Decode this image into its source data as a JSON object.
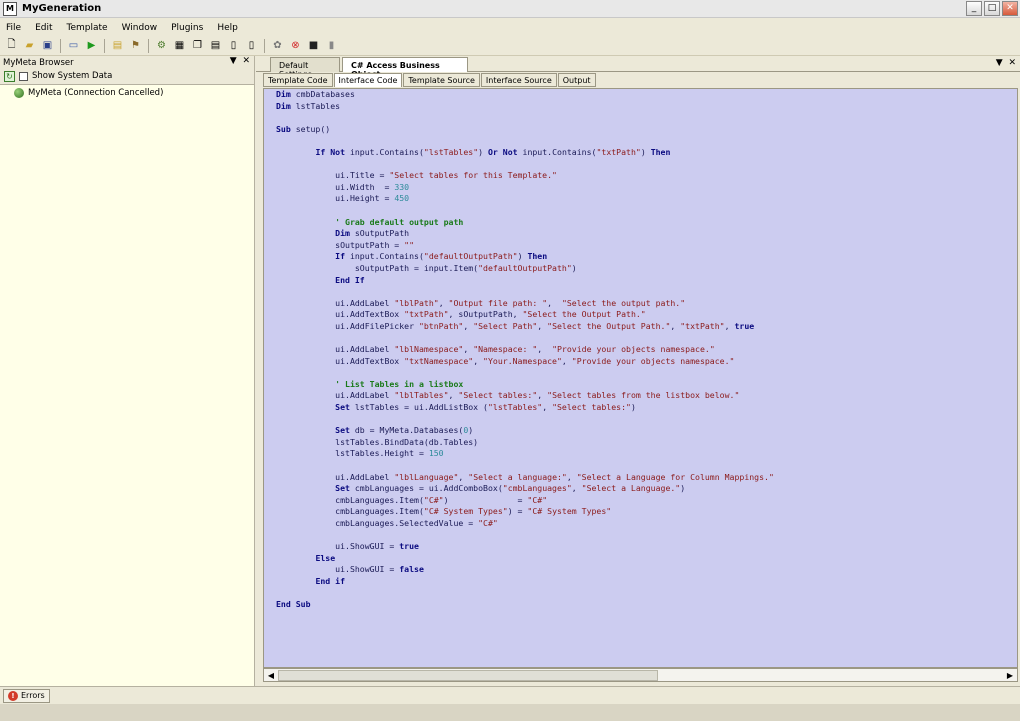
{
  "window": {
    "title": "MyGeneration"
  },
  "menu": [
    "File",
    "Edit",
    "Template",
    "Window",
    "Plugins",
    "Help"
  ],
  "toolbar_icons": [
    "new-icon",
    "open-icon",
    "save-icon",
    "properties-icon",
    "run-icon",
    "folder-icon",
    "wand-icon",
    "build-icon",
    "grid-icon",
    "copy-icon",
    "paste-icon",
    "page-icon",
    "page2-icon",
    "tools-icon",
    "stop-icon",
    "monitor-icon",
    "plugin-icon"
  ],
  "left_panel": {
    "title": "MyMeta Browser",
    "show_system_data": "Show System Data",
    "tree_root": "MyMeta (Connection Cancelled)"
  },
  "doc_tabs": [
    "Default Settings",
    "C# Access Business Object"
  ],
  "sub_tabs": [
    "Template Code",
    "Interface Code",
    "Template Source",
    "Interface Source",
    "Output"
  ],
  "active_sub_tab": 1,
  "status": {
    "errors": "Errors"
  },
  "code_lines": [
    [
      [
        "kw",
        "Dim "
      ],
      [
        "t",
        "cmbDatabases"
      ]
    ],
    [
      [
        "kw",
        "Dim "
      ],
      [
        "t",
        "lstTables"
      ]
    ],
    [],
    [
      [
        "kw",
        "Sub "
      ],
      [
        "t",
        "setup()"
      ]
    ],
    [],
    [
      [
        "t",
        "        "
      ],
      [
        "kw",
        "If Not "
      ],
      [
        "t",
        "input.Contains("
      ],
      [
        "str",
        "\"lstTables\""
      ],
      [
        "t",
        ") "
      ],
      [
        "kw",
        "Or Not "
      ],
      [
        "t",
        "input.Contains("
      ],
      [
        "str",
        "\"txtPath\""
      ],
      [
        "t",
        ") "
      ],
      [
        "kw",
        "Then"
      ]
    ],
    [],
    [
      [
        "t",
        "            ui.Title = "
      ],
      [
        "str",
        "\"Select tables for this Template.\""
      ]
    ],
    [
      [
        "t",
        "            ui.Width  = "
      ],
      [
        "num",
        "330"
      ]
    ],
    [
      [
        "t",
        "            ui.Height = "
      ],
      [
        "num",
        "450"
      ]
    ],
    [],
    [
      [
        "t",
        "            "
      ],
      [
        "cmt",
        "' Grab default output path"
      ]
    ],
    [
      [
        "t",
        "            "
      ],
      [
        "kw",
        "Dim "
      ],
      [
        "t",
        "sOutputPath"
      ]
    ],
    [
      [
        "t",
        "            sOutputPath = "
      ],
      [
        "str",
        "\"\""
      ]
    ],
    [
      [
        "t",
        "            "
      ],
      [
        "kw",
        "If "
      ],
      [
        "t",
        "input.Contains("
      ],
      [
        "str",
        "\"defaultOutputPath\""
      ],
      [
        "t",
        ") "
      ],
      [
        "kw",
        "Then"
      ]
    ],
    [
      [
        "t",
        "                sOutputPath = input.Item("
      ],
      [
        "str",
        "\"defaultOutputPath\""
      ],
      [
        "t",
        ")"
      ]
    ],
    [
      [
        "t",
        "            "
      ],
      [
        "kw",
        "End If"
      ]
    ],
    [],
    [
      [
        "t",
        "            ui.AddLabel "
      ],
      [
        "str",
        "\"lblPath\""
      ],
      [
        "t",
        ", "
      ],
      [
        "str",
        "\"Output file path: \""
      ],
      [
        "t",
        ",  "
      ],
      [
        "str",
        "\"Select the output path.\""
      ]
    ],
    [
      [
        "t",
        "            ui.AddTextBox "
      ],
      [
        "str",
        "\"txtPath\""
      ],
      [
        "t",
        ", sOutputPath, "
      ],
      [
        "str",
        "\"Select the Output Path.\""
      ]
    ],
    [
      [
        "t",
        "            ui.AddFilePicker "
      ],
      [
        "str",
        "\"btnPath\""
      ],
      [
        "t",
        ", "
      ],
      [
        "str",
        "\"Select Path\""
      ],
      [
        "t",
        ", "
      ],
      [
        "str",
        "\"Select the Output Path.\""
      ],
      [
        "t",
        ", "
      ],
      [
        "str",
        "\"txtPath\""
      ],
      [
        "t",
        ", "
      ],
      [
        "kw",
        "true"
      ]
    ],
    [],
    [
      [
        "t",
        "            ui.AddLabel "
      ],
      [
        "str",
        "\"lblNamespace\""
      ],
      [
        "t",
        ", "
      ],
      [
        "str",
        "\"Namespace: \""
      ],
      [
        "t",
        ",  "
      ],
      [
        "str",
        "\"Provide your objects namespace.\""
      ]
    ],
    [
      [
        "t",
        "            ui.AddTextBox "
      ],
      [
        "str",
        "\"txtNamespace\""
      ],
      [
        "t",
        ", "
      ],
      [
        "str",
        "\"Your.Namespace\""
      ],
      [
        "t",
        ", "
      ],
      [
        "str",
        "\"Provide your objects namespace.\""
      ]
    ],
    [],
    [
      [
        "t",
        "            "
      ],
      [
        "cmt",
        "' List Tables in a listbox"
      ]
    ],
    [
      [
        "t",
        "            ui.AddLabel "
      ],
      [
        "str",
        "\"lblTables\""
      ],
      [
        "t",
        ", "
      ],
      [
        "str",
        "\"Select tables:\""
      ],
      [
        "t",
        ", "
      ],
      [
        "str",
        "\"Select tables from the listbox below.\""
      ]
    ],
    [
      [
        "t",
        "            "
      ],
      [
        "kw",
        "Set "
      ],
      [
        "t",
        "lstTables = ui.AddListBox ("
      ],
      [
        "str",
        "\"lstTables\""
      ],
      [
        "t",
        ", "
      ],
      [
        "str",
        "\"Select tables:\""
      ],
      [
        "t",
        ")"
      ]
    ],
    [],
    [
      [
        "t",
        "            "
      ],
      [
        "kw",
        "Set "
      ],
      [
        "t",
        "db = MyMeta.Databases("
      ],
      [
        "num",
        "0"
      ],
      [
        "t",
        ")"
      ]
    ],
    [
      [
        "t",
        "            lstTables.BindData(db.Tables)"
      ]
    ],
    [
      [
        "t",
        "            lstTables.Height = "
      ],
      [
        "num",
        "150"
      ]
    ],
    [],
    [
      [
        "t",
        "            ui.AddLabel "
      ],
      [
        "str",
        "\"lblLanguage\""
      ],
      [
        "t",
        ", "
      ],
      [
        "str",
        "\"Select a language:\""
      ],
      [
        "t",
        ", "
      ],
      [
        "str",
        "\"Select a Language for Column Mappings.\""
      ]
    ],
    [
      [
        "t",
        "            "
      ],
      [
        "kw",
        "Set "
      ],
      [
        "t",
        "cmbLanguages = ui.AddComboBox("
      ],
      [
        "str",
        "\"cmbLanguages\""
      ],
      [
        "t",
        ", "
      ],
      [
        "str",
        "\"Select a Language.\""
      ],
      [
        "t",
        ")"
      ]
    ],
    [
      [
        "t",
        "            cmbLanguages.Item("
      ],
      [
        "str",
        "\"C#\""
      ],
      [
        "t",
        ")              = "
      ],
      [
        "str",
        "\"C#\""
      ]
    ],
    [
      [
        "t",
        "            cmbLanguages.Item("
      ],
      [
        "str",
        "\"C# System Types\""
      ],
      [
        "t",
        ") = "
      ],
      [
        "str",
        "\"C# System Types\""
      ]
    ],
    [
      [
        "t",
        "            cmbLanguages.SelectedValue = "
      ],
      [
        "str",
        "\"C#\""
      ]
    ],
    [],
    [
      [
        "t",
        "            ui.ShowGUI = "
      ],
      [
        "kw",
        "true"
      ]
    ],
    [
      [
        "t",
        "        "
      ],
      [
        "kw",
        "Else"
      ]
    ],
    [
      [
        "t",
        "            ui.ShowGUI = "
      ],
      [
        "kw",
        "false"
      ]
    ],
    [
      [
        "t",
        "        "
      ],
      [
        "kw",
        "End if"
      ]
    ],
    [],
    [
      [
        "kw",
        "End Sub"
      ]
    ]
  ]
}
